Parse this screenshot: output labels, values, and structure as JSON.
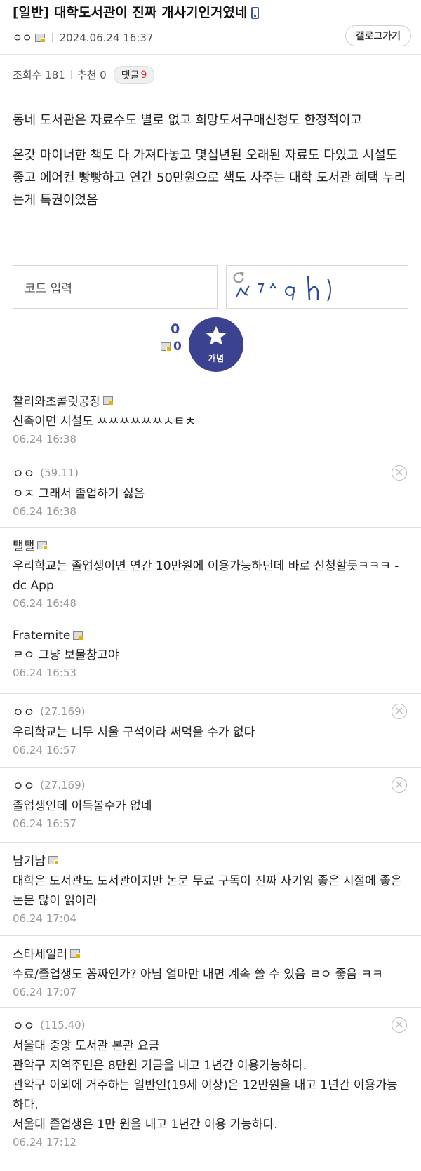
{
  "post": {
    "title": "[일반] 대학도서관이 진짜 개사기인거였네",
    "author": "ㅇㅇ",
    "datetime": "2024.06.24 16:37",
    "gallery_button": "갤로그가기",
    "views_label": "조회수 181",
    "recommend_label": "추천 0",
    "comments_label": "댓글",
    "comments_count": "9",
    "body": [
      "동네 도서관은 자료수도 별로 없고 희망도서구매신청도 한정적이고",
      "온갖 마이너한 책도 다 가져다놓고 몇십년된 오래된 자료도 다있고 시설도 좋고 에어컨 빵빵하고 연간 50만원으로 책도 사주는 대학 도서관 혜택 누리는게 특권이었음"
    ]
  },
  "captcha": {
    "placeholder": "코드 입력"
  },
  "vote": {
    "up_count": "0",
    "down_count": "0",
    "button_label": "개념"
  },
  "comments": [
    {
      "author": "찰리와초콜릿공장",
      "ip": "",
      "text": "신축이면 시설도 ㅆㅆㅆㅆㅆㅆㅅㅌㅊ",
      "date": "06.24 16:38"
    },
    {
      "author": "ㅇㅇ",
      "ip": "(59.11)",
      "text": "ㅇㅈ 그래서 졸업하기 싫음",
      "date": "06.24 16:38"
    },
    {
      "author": "탤탤",
      "ip": "",
      "text": "우리학교는 졸업생이면 연간 10만원에 이용가능하던데 바로 신청할듯ㅋㅋㅋ - dc App",
      "date": "06.24 16:48"
    },
    {
      "author": "Fraternite",
      "ip": "",
      "text": "ㄹㅇ 그냥 보물창고야",
      "date": "06.24 16:53"
    },
    {
      "author": "ㅇㅇ",
      "ip": "(27.169)",
      "text": "우리학교는 너무 서울 구석이라 써먹을 수가 없다",
      "date": "06.24 16:57"
    },
    {
      "author": "ㅇㅇ",
      "ip": "(27.169)",
      "text": "졸업생인데 이득볼수가 없네",
      "date": "06.24 16:57"
    },
    {
      "author": "남기남",
      "ip": "",
      "text": "대학은 도서관도 도서관이지만 논문 무료 구독이 진짜 사기임 좋은 시절에 좋은 논문 많이 읽어라",
      "date": "06.24 17:04"
    },
    {
      "author": "스타세일러",
      "ip": "",
      "text": "수료/졸업생도 꽁짜인가? 아님 얼마만 내면 계속 쓸 수 있음 ㄹㅇ 좋음 ㅋㅋ",
      "date": "06.24 17:07"
    },
    {
      "author": "ㅇㅇ",
      "ip": "(115.40)",
      "text": "서울대 중앙 도서관 본관 요금\n관악구 지역주민은 8만원 기금을 내고 1년간 이용가능하다.\n관악구 이외에 거주하는 일반인(19세 이상)은 12만원을 내고 1년간 이용가능하다.\n서울대 졸업생은 1만 원을 내고 1년간 이용 가능하다.",
      "date": "06.24 17:12"
    }
  ]
}
